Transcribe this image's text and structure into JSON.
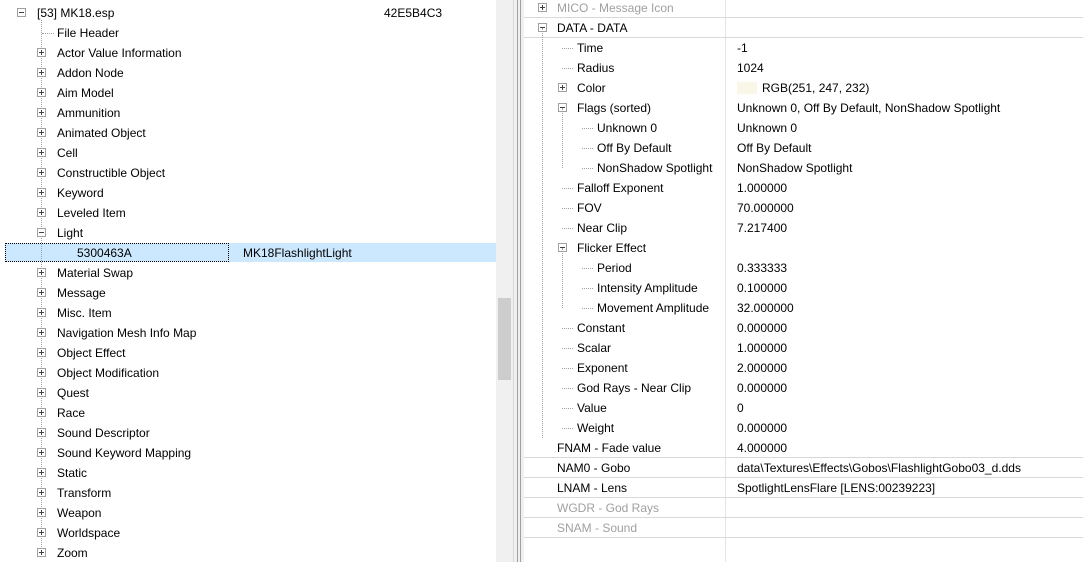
{
  "tree": {
    "root": {
      "label": "[53] MK18.esp",
      "formid": "42E5B4C3"
    },
    "items": [
      {
        "label": "File Header",
        "expand": "none"
      },
      {
        "label": "Actor Value Information",
        "expand": "plus"
      },
      {
        "label": "Addon Node",
        "expand": "plus"
      },
      {
        "label": "Aim Model",
        "expand": "plus"
      },
      {
        "label": "Ammunition",
        "expand": "plus"
      },
      {
        "label": "Animated Object",
        "expand": "plus"
      },
      {
        "label": "Cell",
        "expand": "plus"
      },
      {
        "label": "Constructible Object",
        "expand": "plus"
      },
      {
        "label": "Keyword",
        "expand": "plus"
      },
      {
        "label": "Leveled Item",
        "expand": "plus"
      },
      {
        "label": "Light",
        "expand": "minus"
      },
      {
        "label": "Material Swap",
        "expand": "plus"
      },
      {
        "label": "Message",
        "expand": "plus"
      },
      {
        "label": "Misc. Item",
        "expand": "plus"
      },
      {
        "label": "Navigation Mesh Info Map",
        "expand": "plus"
      },
      {
        "label": "Object Effect",
        "expand": "plus"
      },
      {
        "label": "Object Modification",
        "expand": "plus"
      },
      {
        "label": "Quest",
        "expand": "plus"
      },
      {
        "label": "Race",
        "expand": "plus"
      },
      {
        "label": "Sound Descriptor",
        "expand": "plus"
      },
      {
        "label": "Sound Keyword Mapping",
        "expand": "plus"
      },
      {
        "label": "Static",
        "expand": "plus"
      },
      {
        "label": "Transform",
        "expand": "plus"
      },
      {
        "label": "Weapon",
        "expand": "plus"
      },
      {
        "label": "Worldspace",
        "expand": "plus"
      },
      {
        "label": "Zoom",
        "expand": "plus"
      }
    ],
    "selected": {
      "formid": "5300463A",
      "editor_id": "MK18FlashlightLight"
    }
  },
  "record": {
    "rows": [
      {
        "key": "MICO - Message Icon",
        "value": "",
        "level": 0,
        "expand": "plus",
        "grey": true
      },
      {
        "key": "DATA - DATA",
        "value": "",
        "level": 0,
        "expand": "minus"
      },
      {
        "key": "Time",
        "value": "-1",
        "level": 1
      },
      {
        "key": "Radius",
        "value": "1024",
        "level": 1
      },
      {
        "key": "Color",
        "value": "RGB(251, 247, 232)",
        "level": 1,
        "expand": "plus",
        "swatch": "#fbf7e8"
      },
      {
        "key": "Flags (sorted)",
        "value": "Unknown 0, Off By Default, NonShadow Spotlight",
        "level": 1,
        "expand": "minus"
      },
      {
        "key": "Unknown 0",
        "value": "Unknown 0",
        "level": 2
      },
      {
        "key": "Off By Default",
        "value": "Off By Default",
        "level": 2
      },
      {
        "key": "NonShadow Spotlight",
        "value": "NonShadow Spotlight",
        "level": 2
      },
      {
        "key": "Falloff Exponent",
        "value": "1.000000",
        "level": 1
      },
      {
        "key": "FOV",
        "value": "70.000000",
        "level": 1
      },
      {
        "key": "Near Clip",
        "value": "7.217400",
        "level": 1
      },
      {
        "key": "Flicker Effect",
        "value": "",
        "level": 1,
        "expand": "minus"
      },
      {
        "key": "Period",
        "value": "0.333333",
        "level": 2
      },
      {
        "key": "Intensity Amplitude",
        "value": "0.100000",
        "level": 2
      },
      {
        "key": "Movement Amplitude",
        "value": "32.000000",
        "level": 2
      },
      {
        "key": "Constant",
        "value": "0.000000",
        "level": 1
      },
      {
        "key": "Scalar",
        "value": "1.000000",
        "level": 1
      },
      {
        "key": "Exponent",
        "value": "2.000000",
        "level": 1
      },
      {
        "key": "God Rays - Near Clip",
        "value": "0.000000",
        "level": 1
      },
      {
        "key": "Value",
        "value": "0",
        "level": 1
      },
      {
        "key": "Weight",
        "value": "0.000000",
        "level": 1
      },
      {
        "key": "FNAM - Fade value",
        "value": "4.000000",
        "level": 0
      },
      {
        "key": "NAM0 - Gobo",
        "value": "data\\Textures\\Effects\\Gobos\\FlashlightGobo03_d.dds",
        "level": 0
      },
      {
        "key": "LNAM - Lens",
        "value": "SpotlightLensFlare [LENS:00239223]",
        "level": 0
      },
      {
        "key": "WGDR - God Rays",
        "value": "",
        "level": 0,
        "grey": true
      },
      {
        "key": "SNAM - Sound",
        "value": "",
        "level": 0,
        "grey": true
      }
    ]
  }
}
